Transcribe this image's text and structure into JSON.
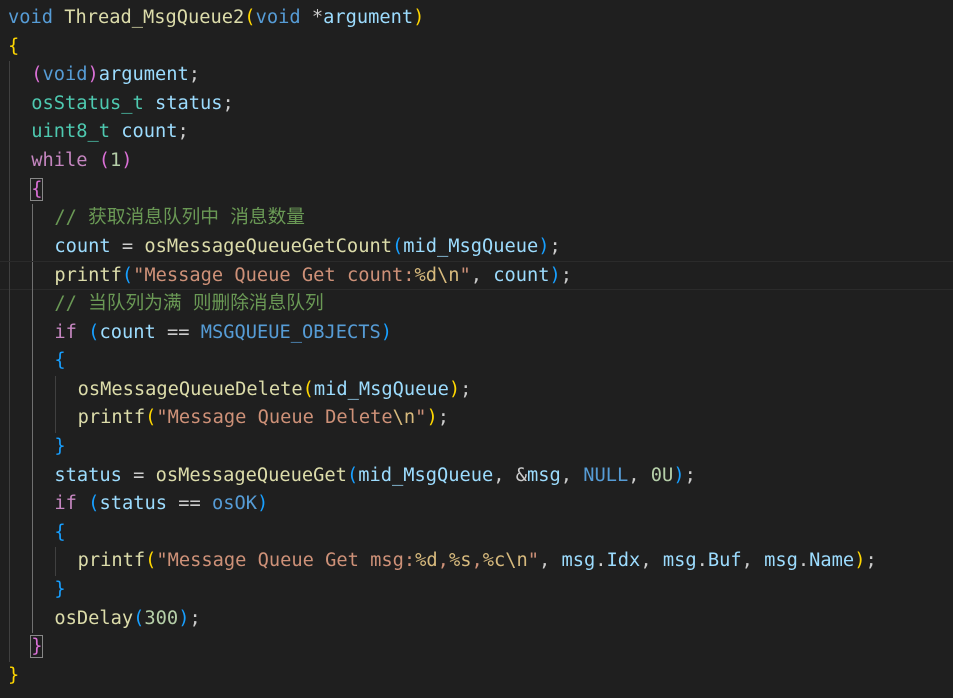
{
  "editor": {
    "language": "c",
    "current_line": 10,
    "lines": [
      {
        "indent": 0,
        "tokens": [
          {
            "t": "void",
            "k": "kw"
          },
          {
            "t": " ",
            "k": "punc"
          },
          {
            "t": "Thread_MsgQueue2",
            "k": "fn"
          },
          {
            "t": "(",
            "k": "b1"
          },
          {
            "t": "void",
            "k": "kw"
          },
          {
            "t": " *",
            "k": "punc"
          },
          {
            "t": "argument",
            "k": "var"
          },
          {
            "t": ")",
            "k": "b1"
          }
        ]
      },
      {
        "indent": 0,
        "tokens": [
          {
            "t": "{",
            "k": "b1"
          }
        ]
      },
      {
        "indent": 1,
        "tokens": [
          {
            "t": "(",
            "k": "b2"
          },
          {
            "t": "void",
            "k": "kw"
          },
          {
            "t": ")",
            "k": "b2"
          },
          {
            "t": "argument",
            "k": "var"
          },
          {
            "t": ";",
            "k": "punc"
          }
        ]
      },
      {
        "indent": 1,
        "tokens": [
          {
            "t": "osStatus_t",
            "k": "type"
          },
          {
            "t": " ",
            "k": "punc"
          },
          {
            "t": "status",
            "k": "var"
          },
          {
            "t": ";",
            "k": "punc"
          }
        ]
      },
      {
        "indent": 1,
        "tokens": [
          {
            "t": "uint8_t",
            "k": "type"
          },
          {
            "t": " ",
            "k": "punc"
          },
          {
            "t": "count",
            "k": "var"
          },
          {
            "t": ";",
            "k": "punc"
          }
        ]
      },
      {
        "indent": 1,
        "tokens": [
          {
            "t": "while",
            "k": "ctrl"
          },
          {
            "t": " ",
            "k": "punc"
          },
          {
            "t": "(",
            "k": "b2"
          },
          {
            "t": "1",
            "k": "num"
          },
          {
            "t": ")",
            "k": "b2"
          }
        ]
      },
      {
        "indent": 1,
        "tokens": [
          {
            "t": "{",
            "k": "b2",
            "match": true
          }
        ]
      },
      {
        "indent": 2,
        "tokens": [
          {
            "t": "// 获取消息队列中 消息数量",
            "k": "cmt"
          }
        ]
      },
      {
        "indent": 2,
        "tokens": [
          {
            "t": "count",
            "k": "var"
          },
          {
            "t": " = ",
            "k": "punc"
          },
          {
            "t": "osMessageQueueGetCount",
            "k": "fn"
          },
          {
            "t": "(",
            "k": "b3"
          },
          {
            "t": "mid_MsgQueue",
            "k": "var"
          },
          {
            "t": ")",
            "k": "b3"
          },
          {
            "t": ";",
            "k": "punc"
          }
        ]
      },
      {
        "indent": 2,
        "tokens": [
          {
            "t": "printf",
            "k": "fn"
          },
          {
            "t": "(",
            "k": "b3"
          },
          {
            "t": "\"Message Queue Get count:",
            "k": "str"
          },
          {
            "t": "%d\\n",
            "k": "esc"
          },
          {
            "t": "\"",
            "k": "str"
          },
          {
            "t": ", ",
            "k": "punc"
          },
          {
            "t": "count",
            "k": "var"
          },
          {
            "t": ")",
            "k": "b3"
          },
          {
            "t": ";",
            "k": "punc"
          }
        ]
      },
      {
        "indent": 2,
        "tokens": [
          {
            "t": "// 当队列为满 则删除消息队列",
            "k": "cmt"
          }
        ]
      },
      {
        "indent": 2,
        "tokens": [
          {
            "t": "if",
            "k": "ctrl"
          },
          {
            "t": " ",
            "k": "punc"
          },
          {
            "t": "(",
            "k": "b3"
          },
          {
            "t": "count",
            "k": "var"
          },
          {
            "t": " == ",
            "k": "punc"
          },
          {
            "t": "MSGQUEUE_OBJECTS",
            "k": "macro"
          },
          {
            "t": ")",
            "k": "b3"
          }
        ]
      },
      {
        "indent": 2,
        "tokens": [
          {
            "t": "{",
            "k": "b3"
          }
        ]
      },
      {
        "indent": 3,
        "tokens": [
          {
            "t": "osMessageQueueDelete",
            "k": "fn"
          },
          {
            "t": "(",
            "k": "b1"
          },
          {
            "t": "mid_MsgQueue",
            "k": "var"
          },
          {
            "t": ")",
            "k": "b1"
          },
          {
            "t": ";",
            "k": "punc"
          }
        ]
      },
      {
        "indent": 3,
        "tokens": [
          {
            "t": "printf",
            "k": "fn"
          },
          {
            "t": "(",
            "k": "b1"
          },
          {
            "t": "\"Message Queue Delete",
            "k": "str"
          },
          {
            "t": "\\n",
            "k": "esc"
          },
          {
            "t": "\"",
            "k": "str"
          },
          {
            "t": ")",
            "k": "b1"
          },
          {
            "t": ";",
            "k": "punc"
          }
        ]
      },
      {
        "indent": 2,
        "tokens": [
          {
            "t": "}",
            "k": "b3"
          }
        ]
      },
      {
        "indent": 2,
        "tokens": [
          {
            "t": "status",
            "k": "var"
          },
          {
            "t": " = ",
            "k": "punc"
          },
          {
            "t": "osMessageQueueGet",
            "k": "fn"
          },
          {
            "t": "(",
            "k": "b3"
          },
          {
            "t": "mid_MsgQueue",
            "k": "var"
          },
          {
            "t": ", &",
            "k": "punc"
          },
          {
            "t": "msg",
            "k": "var"
          },
          {
            "t": ", ",
            "k": "punc"
          },
          {
            "t": "NULL",
            "k": "macro"
          },
          {
            "t": ", ",
            "k": "punc"
          },
          {
            "t": "0U",
            "k": "num"
          },
          {
            "t": ")",
            "k": "b3"
          },
          {
            "t": ";",
            "k": "punc"
          }
        ]
      },
      {
        "indent": 2,
        "tokens": [
          {
            "t": "if",
            "k": "ctrl"
          },
          {
            "t": " ",
            "k": "punc"
          },
          {
            "t": "(",
            "k": "b3"
          },
          {
            "t": "status",
            "k": "var"
          },
          {
            "t": " == ",
            "k": "punc"
          },
          {
            "t": "osOK",
            "k": "macro"
          },
          {
            "t": ")",
            "k": "b3"
          }
        ]
      },
      {
        "indent": 2,
        "tokens": [
          {
            "t": "{",
            "k": "b3"
          }
        ]
      },
      {
        "indent": 3,
        "tokens": [
          {
            "t": "printf",
            "k": "fn"
          },
          {
            "t": "(",
            "k": "b1"
          },
          {
            "t": "\"Message Queue Get msg:",
            "k": "str"
          },
          {
            "t": "%d",
            "k": "esc"
          },
          {
            "t": ",",
            "k": "str"
          },
          {
            "t": "%s",
            "k": "esc"
          },
          {
            "t": ",",
            "k": "str"
          },
          {
            "t": "%c\\n",
            "k": "esc"
          },
          {
            "t": "\"",
            "k": "str"
          },
          {
            "t": ", ",
            "k": "punc"
          },
          {
            "t": "msg",
            "k": "var"
          },
          {
            "t": ".",
            "k": "punc"
          },
          {
            "t": "Idx",
            "k": "var"
          },
          {
            "t": ", ",
            "k": "punc"
          },
          {
            "t": "msg",
            "k": "var"
          },
          {
            "t": ".",
            "k": "punc"
          },
          {
            "t": "Buf",
            "k": "var"
          },
          {
            "t": ", ",
            "k": "punc"
          },
          {
            "t": "msg",
            "k": "var"
          },
          {
            "t": ".",
            "k": "punc"
          },
          {
            "t": "Name",
            "k": "var"
          },
          {
            "t": ")",
            "k": "b1"
          },
          {
            "t": ";",
            "k": "punc"
          }
        ]
      },
      {
        "indent": 2,
        "tokens": [
          {
            "t": "}",
            "k": "b3"
          }
        ]
      },
      {
        "indent": 2,
        "tokens": [
          {
            "t": "osDelay",
            "k": "fn"
          },
          {
            "t": "(",
            "k": "b3"
          },
          {
            "t": "300",
            "k": "num"
          },
          {
            "t": ")",
            "k": "b3"
          },
          {
            "t": ";",
            "k": "punc"
          }
        ]
      },
      {
        "indent": 1,
        "tokens": [
          {
            "t": "}",
            "k": "b2",
            "match": true
          }
        ]
      },
      {
        "indent": 0,
        "tokens": [
          {
            "t": "}",
            "k": "b1"
          }
        ]
      }
    ]
  }
}
